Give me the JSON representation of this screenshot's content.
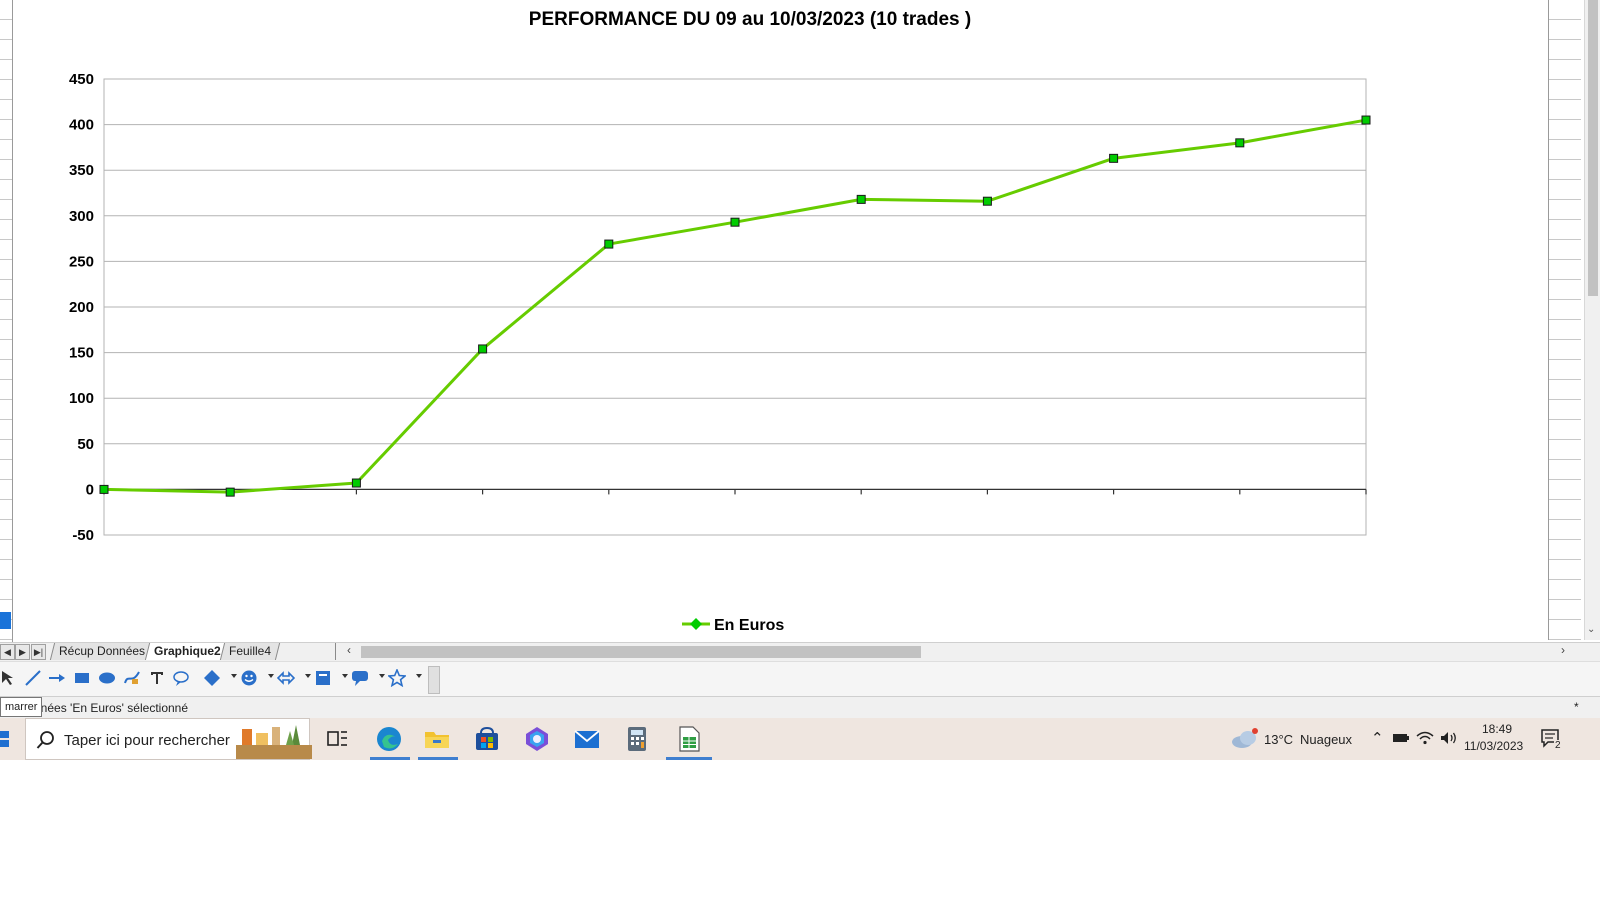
{
  "chart_data": {
    "type": "line",
    "title": "PERFORMANCE DU 09 au 10/03/2023 (10 trades )",
    "x": [
      0,
      1,
      2,
      3,
      4,
      5,
      6,
      7,
      8,
      9,
      10
    ],
    "series": [
      {
        "name": "En Euros",
        "values": [
          0,
          -3,
          7,
          154,
          269,
          293,
          318,
          316,
          363,
          380,
          405
        ],
        "color": "#66cc00",
        "marker_color": "#00cc00"
      }
    ],
    "ylim": [
      -50,
      450
    ],
    "yticks": [
      -50,
      0,
      50,
      100,
      150,
      200,
      250,
      300,
      350,
      400,
      450
    ],
    "ytick_labels": [
      "-50",
      "0",
      "50",
      "100",
      "150",
      "200",
      "250",
      "300",
      "350",
      "400",
      "450"
    ],
    "grid": true,
    "legend": "bottom-center",
    "xlabel": "",
    "ylabel": ""
  },
  "sheets": {
    "tabs": [
      {
        "label": "Récup Données",
        "active": false
      },
      {
        "label": "Graphique2",
        "active": true
      },
      {
        "label": "Feuille4",
        "active": false
      }
    ]
  },
  "status": {
    "tooltip": "marrer",
    "text": "nnées 'En Euros' sélectionné",
    "modified": "*"
  },
  "taskbar": {
    "search_placeholder": "Taper ici pour rechercher",
    "weather_temp": "13°C",
    "weather_desc": "Nuageux",
    "time": "18:49",
    "date": "11/03/2023",
    "notification_count": "2"
  },
  "colors": {
    "line": "#66cc00",
    "marker": "#00cc00",
    "taskbar": "#efe6e0",
    "accent": "#3f7fd0"
  }
}
